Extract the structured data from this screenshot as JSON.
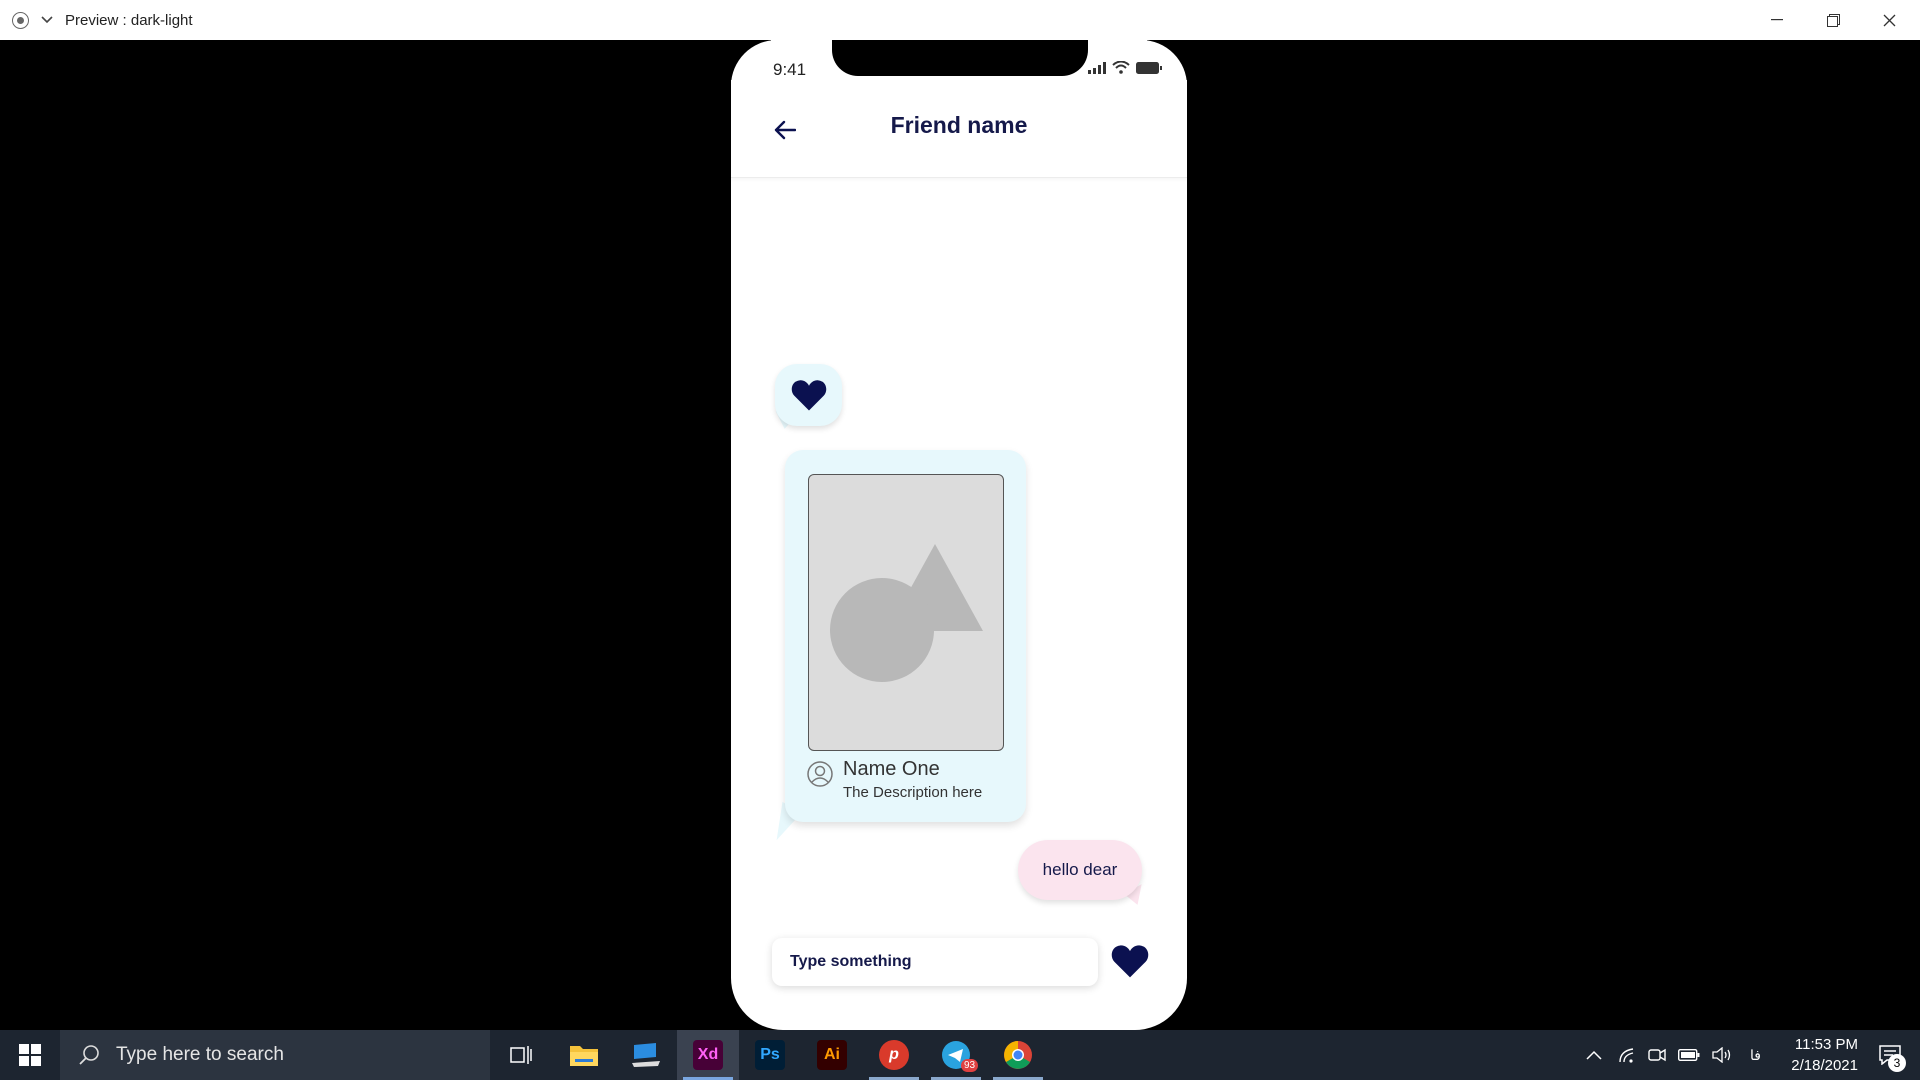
{
  "window": {
    "title": "Preview : dark-light"
  },
  "phone": {
    "status_time": "9:41",
    "header": {
      "title": "Friend name"
    },
    "messages": {
      "card": {
        "name": "Name One",
        "description": "The Description here"
      },
      "outgoing_text": "hello dear"
    },
    "composer": {
      "placeholder": "Type something"
    }
  },
  "taskbar": {
    "search_placeholder": "Type here to search",
    "apps": [
      {
        "label": "Xd",
        "color": "#ff61f6",
        "bg": "#470137"
      },
      {
        "label": "Ps",
        "color": "#31a8ff",
        "bg": "#001e36"
      },
      {
        "label": "Ai",
        "color": "#ff9a00",
        "bg": "#330000"
      }
    ],
    "telegram_badge": "93",
    "lang": "فا",
    "time": "11:53 PM",
    "date": "2/18/2021",
    "notification_count": "3"
  },
  "colors": {
    "heart": "#0b1150",
    "incoming_bubble": "#e7f8fc",
    "outgoing_bubble": "#fbe4ee",
    "accent_text": "#15194a"
  }
}
